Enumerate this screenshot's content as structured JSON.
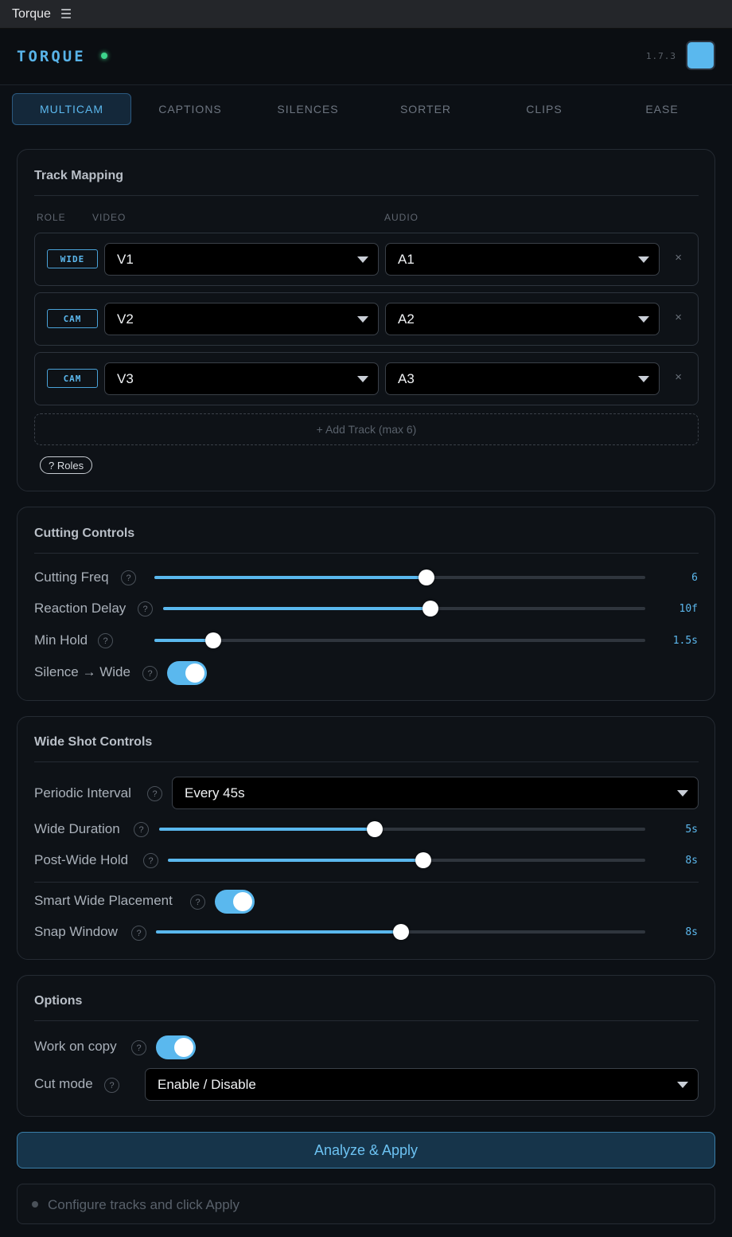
{
  "titlebar": {
    "app_name": "Torque",
    "menu_icon": "☰"
  },
  "header": {
    "brand": "TORQUE",
    "version": "1.7.3",
    "accent_color": "#5ab8ee",
    "status_color": "#3dd68c"
  },
  "tabs": [
    {
      "label": "MULTICAM",
      "active": true
    },
    {
      "label": "CAPTIONS",
      "active": false
    },
    {
      "label": "SILENCES",
      "active": false
    },
    {
      "label": "SORTER",
      "active": false
    },
    {
      "label": "CLIPS",
      "active": false
    },
    {
      "label": "EASE",
      "active": false
    }
  ],
  "track_mapping": {
    "title": "Track Mapping",
    "columns": {
      "role": "ROLE",
      "video": "VIDEO",
      "audio": "AUDIO"
    },
    "rows": [
      {
        "role": "WIDE",
        "video": "V1",
        "audio": "A1",
        "remove": "×"
      },
      {
        "role": "CAM",
        "video": "V2",
        "audio": "A2",
        "remove": "×"
      },
      {
        "role": "CAM",
        "video": "V3",
        "audio": "A3",
        "remove": "×"
      }
    ],
    "add_track": "+ Add Track (max 6)",
    "roles_help": "? Roles"
  },
  "cutting_controls": {
    "title": "Cutting Controls",
    "cutting_freq": {
      "label": "Cutting Freq",
      "value": "6",
      "fraction": 0.555
    },
    "reaction_delay": {
      "label": "Reaction Delay",
      "value": "10f",
      "fraction": 0.555
    },
    "min_hold": {
      "label": "Min Hold",
      "value": "1.5s",
      "fraction": 0.12
    },
    "silence_wide": {
      "label": "Silence → Wide",
      "on": true
    }
  },
  "wide_shot_controls": {
    "title": "Wide Shot Controls",
    "periodic_interval": {
      "label": "Periodic Interval",
      "value": "Every 45s"
    },
    "wide_duration": {
      "label": "Wide Duration",
      "value": "5s",
      "fraction": 0.444
    },
    "post_wide_hold": {
      "label": "Post-Wide Hold",
      "value": "8s",
      "fraction": 0.535
    },
    "smart_wide_placement": {
      "label": "Smart Wide Placement",
      "on": true
    },
    "snap_window": {
      "label": "Snap Window",
      "value": "8s",
      "fraction": 0.5
    }
  },
  "options": {
    "title": "Options",
    "work_on_copy": {
      "label": "Work on copy",
      "on": true
    },
    "cut_mode": {
      "label": "Cut mode",
      "value": "Enable / Disable"
    }
  },
  "help_glyph": "?",
  "apply_button": "Analyze & Apply",
  "status_text": "Configure tracks and click Apply"
}
